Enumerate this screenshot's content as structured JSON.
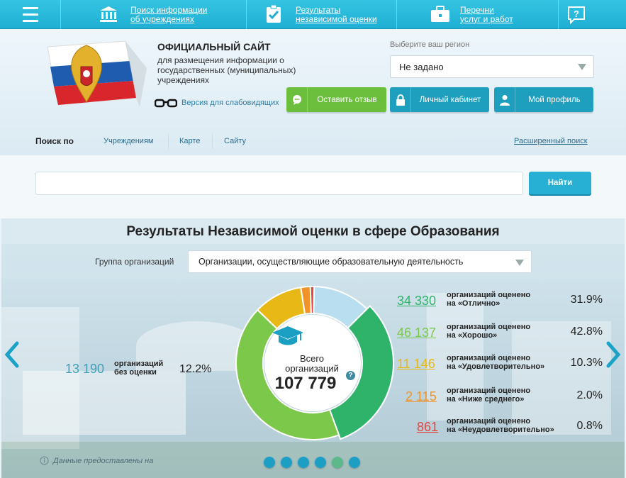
{
  "nav": {
    "items": [
      {
        "label_l1": "Поиск информации",
        "label_l2": "об учреждениях",
        "icon": "institution-icon"
      },
      {
        "label_l1": "Результаты",
        "label_l2": "независимой оценки",
        "icon": "checklist-icon"
      },
      {
        "label_l1": "Перечни",
        "label_l2": "услуг и работ",
        "icon": "briefcase-icon"
      }
    ],
    "help_icon": "help-chat-icon"
  },
  "header": {
    "title": "ОФИЦИАЛЬНЫЙ САЙТ",
    "subtitle": "для размещения информации о государственных (муниципальных) учреждениях",
    "vision_link": "Версия для слабовидящих",
    "region_label": "Выберите ваш регион",
    "region_value": "Не задано",
    "btn_feedback": "Оставить отзыв",
    "btn_cabinet": "Личный кабинет",
    "btn_profile": "Мой профиль"
  },
  "search": {
    "by_label": "Поиск по",
    "tabs": [
      "Учреждениям",
      "Карте",
      "Сайту"
    ],
    "advanced": "Расширенный поиск",
    "placeholder": "",
    "button": "Найти"
  },
  "results": {
    "title": "Результаты Независимой оценки в сфере Образования",
    "group_label": "Группа организаций",
    "group_value": "Организации, осуществляющие образовательную деятельность",
    "unrated": {
      "count": "13 190",
      "label_l1": "организаций",
      "label_l2": "без оценки",
      "pct": "12.2%"
    },
    "rows": [
      {
        "count": "34 330",
        "l1": "организаций оценено",
        "l2": "на «Отлично»",
        "pct": "31.9%",
        "color": "#2fb36a"
      },
      {
        "count": "46 137",
        "l1": "организаций оценено",
        "l2": "на «Хорошо»",
        "pct": "42.8%",
        "color": "#7cc84a"
      },
      {
        "count": "11 146",
        "l1": "организаций оценено",
        "l2": "на «Удовлетворительно»",
        "pct": "10.3%",
        "color": "#e8b817"
      },
      {
        "count": "2 115",
        "l1": "организаций оценено",
        "l2": "на «Ниже среднего»",
        "pct": "2.0%",
        "color": "#f0932a"
      },
      {
        "count": "861",
        "l1": "организаций оценено",
        "l2": "на «Неудовлетворительно»",
        "pct": "0.8%",
        "color": "#e2463e"
      }
    ],
    "center_l1": "Всего",
    "center_l2": "организаций",
    "total": "107 779",
    "help": "?",
    "note": "Данные предоставлены на",
    "slides": 6,
    "active_slide": 4
  },
  "chart_data": {
    "type": "pie",
    "categories": [
      "без оценки",
      "Отлично",
      "Хорошо",
      "Удовлетворительно",
      "Ниже среднего",
      "Неудовлетворительно"
    ],
    "values": [
      12.2,
      31.9,
      42.8,
      10.3,
      2.0,
      0.8
    ],
    "colors": [
      "#b9def0",
      "#2fb36a",
      "#7cc84a",
      "#e8b817",
      "#f0932a",
      "#e2463e"
    ]
  }
}
